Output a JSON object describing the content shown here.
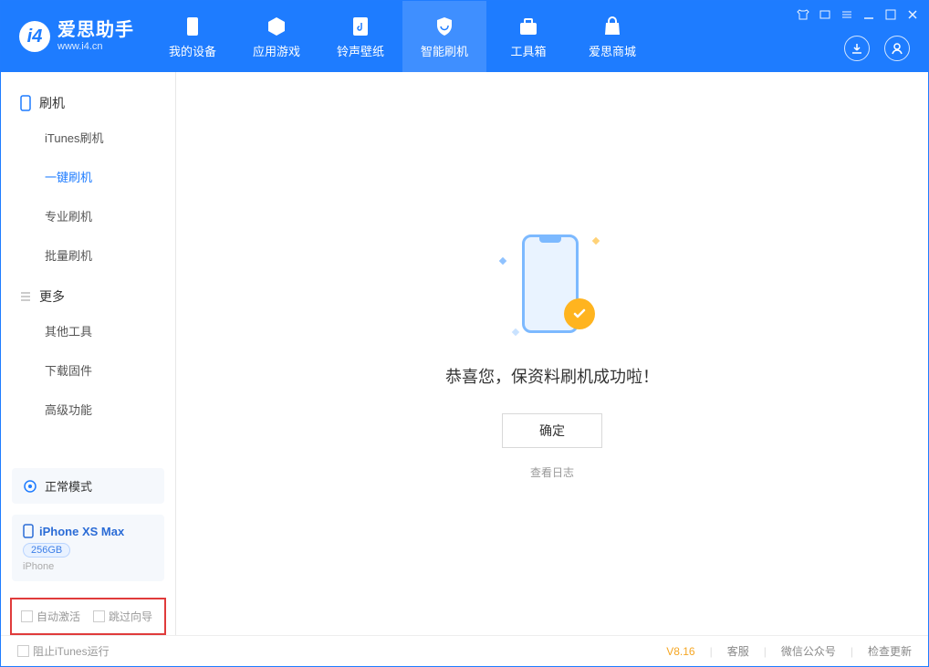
{
  "app": {
    "name_cn": "爱思助手",
    "name_en": "www.i4.cn"
  },
  "nav": [
    "我的设备",
    "应用游戏",
    "铃声壁纸",
    "智能刷机",
    "工具箱",
    "爱思商城"
  ],
  "nav_active_index": 3,
  "sidebar": {
    "group_flash": "刷机",
    "items_flash": [
      "iTunes刷机",
      "一键刷机",
      "专业刷机",
      "批量刷机"
    ],
    "items_flash_active_index": 1,
    "group_more": "更多",
    "items_more": [
      "其他工具",
      "下载固件",
      "高级功能"
    ],
    "mode_label": "正常模式",
    "device": {
      "name": "iPhone XS Max",
      "storage": "256GB",
      "type": "iPhone"
    },
    "opt_auto_activate": "自动激活",
    "opt_skip_guide": "跳过向导"
  },
  "content": {
    "success_msg": "恭喜您，保资料刷机成功啦！",
    "ok_btn": "确定",
    "view_log": "查看日志"
  },
  "footer": {
    "block_itunes": "阻止iTunes运行",
    "version": "V8.16",
    "links": [
      "客服",
      "微信公众号",
      "检查更新"
    ]
  },
  "colors": {
    "primary": "#1e7cff",
    "accent": "#ffb41f",
    "highlight_border": "#e03b3b"
  }
}
